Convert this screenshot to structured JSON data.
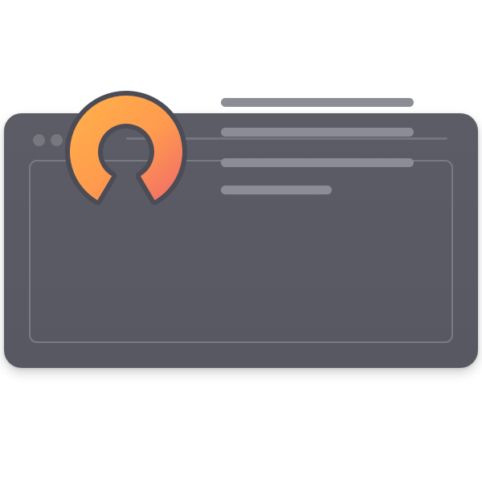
{
  "illustration": {
    "kind": "browser-window-dashboard-icon",
    "colors": {
      "page_background": "#ffffff",
      "window_background": "#585862",
      "window_top": "#5c5c66",
      "panel_border": "#7a7a86",
      "dot": "#77777f",
      "titlebar_line": "#74747e",
      "placeholder_line": "#8c8c96",
      "gauge_outline": "#4c4c56",
      "gauge_gradient_start": "#ffb24a",
      "gauge_gradient_mid": "#ff9a4e",
      "gauge_gradient_end": "#f06a6a"
    },
    "window_controls": [
      "dot",
      "dot",
      "dot"
    ],
    "gauge": {
      "icon": "gauge-icon",
      "level": 0.83
    },
    "placeholder_lines": 4
  }
}
